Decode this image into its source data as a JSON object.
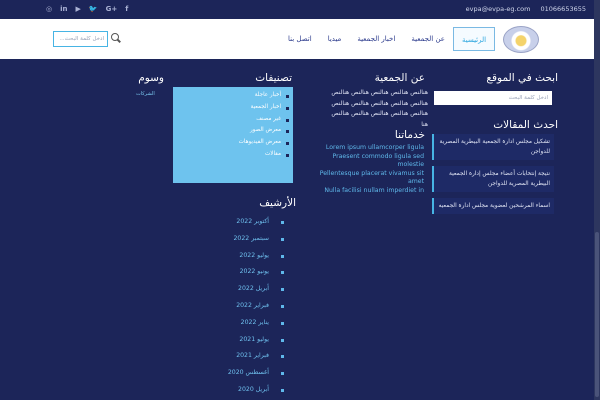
{
  "topbar": {
    "social": [
      "f",
      "G+",
      "🐦",
      "▶",
      "in",
      "◎"
    ],
    "email": "evpa@evpa-eg.com",
    "phone": "01066653655"
  },
  "nav": {
    "items": [
      "الرئيسية",
      "عن الجمعية",
      "اخبار الجمعية",
      "ميديا",
      "اتصل بنا"
    ]
  },
  "search": {
    "placeholder": "ادخل كلمة البحث..."
  },
  "site_search": {
    "title": "ابحث في الموقع",
    "placeholder": "ادخل كلمة البحث"
  },
  "articles": {
    "title": "احدث المقالات",
    "items": [
      "تشكيل مجلس ادارة الجمعية البيطرية المصرية للدواجن",
      "نتيجة إنتخابات أعضاء مجلس إدارة الجمعية البيطرية المصرية للدواجن",
      "اسماء المرشحين لعضوية مجلس ادارة الجمعيه"
    ]
  },
  "about": {
    "title": "عن الجمعية",
    "text": "هنالنص هنالنص هنالنص هنالنص هنالنص هنالنص هنالنص هنالنص هنالنص هنالنص هنالنص هنالنص هنالنص هنالنص هنالنص هنا"
  },
  "services": {
    "title": "خدماتنا",
    "lines": [
      "Lorem ipsum ullamcorper ligula",
      "Praesent commodo ligula sed molestie",
      "Pellentesque placerat vivamus sit amet",
      "Nulla facilisi nullam imperdiet in"
    ]
  },
  "categories": {
    "title": "تصنيفات",
    "items": [
      "أخبار عاجلة",
      "اخبار الجمعية",
      "غير مصنف",
      "معرض الصور",
      "معرض الفيديوهات",
      "مقالات"
    ]
  },
  "tags": {
    "title": "وسوم",
    "link": "الشركات"
  },
  "archive": {
    "title": "الأرشيف",
    "items": [
      "أكتوبر 2022",
      "سبتمبر 2022",
      "يوليو 2022",
      "يونيو 2022",
      "أبريل 2022",
      "فبراير 2022",
      "يناير 2022",
      "يوليو 2021",
      "فبراير 2021",
      "أغسطس 2020",
      "أبريل 2020"
    ]
  }
}
